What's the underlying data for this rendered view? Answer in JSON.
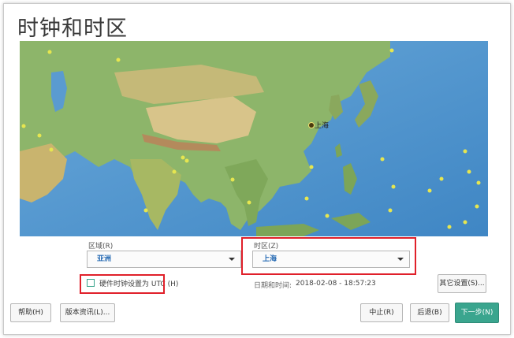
{
  "page": {
    "title": "时钟和时区"
  },
  "map": {
    "selected_city": "上海"
  },
  "region": {
    "label": "区域(R)",
    "value": "亚洲"
  },
  "timezone": {
    "label": "时区(Z)",
    "value": "上海"
  },
  "utc": {
    "label": "硬件时钟设置为 UTC (H)",
    "checked": false
  },
  "datetime": {
    "label": "日期和时间:",
    "value": "2018-02-08 - 18:57:23"
  },
  "buttons": {
    "other_settings": "其它设置(S)...",
    "help": "帮助(H)",
    "release_notes": "版本资讯(L)...",
    "abort": "中止(R)",
    "back": "后退(B)",
    "next": "下一步(N)"
  },
  "colors": {
    "accent": "#3aa58e",
    "highlight": "#e0202a",
    "link": "#2a6db5"
  }
}
